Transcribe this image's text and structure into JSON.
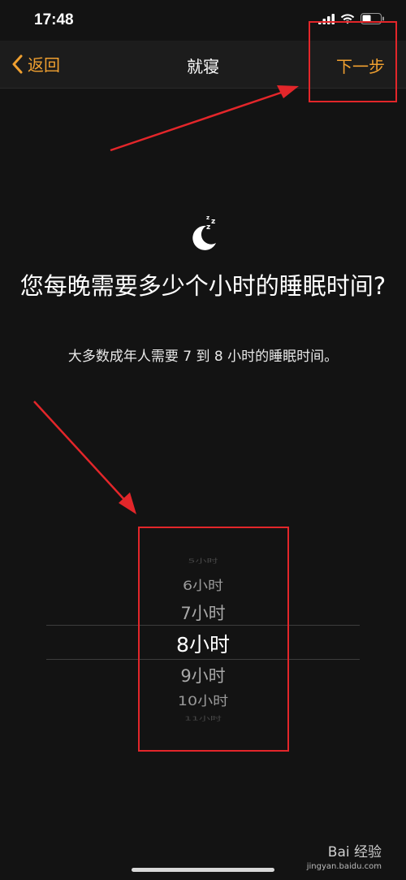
{
  "status": {
    "time": "17:48"
  },
  "nav": {
    "back_label": "返回",
    "title": "就寝",
    "next_label": "下一步"
  },
  "main": {
    "question": "您每晚需要多少个小时的睡眠时间?",
    "subtitle": "大多数成年人需要 7 到 8 小时的睡眠时间。"
  },
  "picker": {
    "items": [
      "5小时",
      "6小时",
      "7小时",
      "8小时",
      "9小时",
      "10小时",
      "11小时"
    ],
    "selected": "8小时"
  },
  "watermark": {
    "brand": "Bai 经验",
    "url": "jingyan.baidu.com"
  },
  "colors": {
    "accent": "#f0a030",
    "annotation": "#e3262a",
    "background": "#131313"
  }
}
